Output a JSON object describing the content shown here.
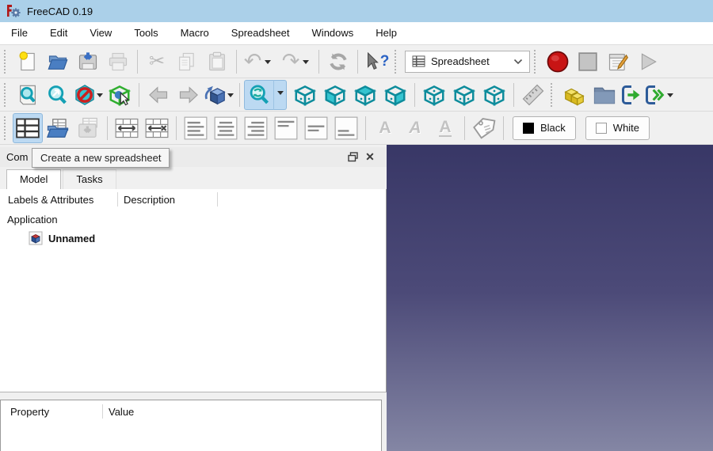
{
  "window": {
    "title": "FreeCAD 0.19"
  },
  "menu": {
    "items": [
      "File",
      "Edit",
      "View",
      "Tools",
      "Macro",
      "Spreadsheet",
      "Windows",
      "Help"
    ]
  },
  "workbench": {
    "selected": "Spreadsheet"
  },
  "color_buttons": {
    "black": "Black",
    "white": "White"
  },
  "tooltip": {
    "text": "Create a new spreadsheet"
  },
  "dock": {
    "title": "Com",
    "tabs": {
      "model": "Model",
      "tasks": "Tasks"
    },
    "tree": {
      "col1": "Labels & Attributes",
      "col2": "Description",
      "root": "Application",
      "document": "Unnamed"
    },
    "properties": {
      "col1": "Property",
      "col2": "Value"
    }
  },
  "glyphs": {
    "scissors": "✂",
    "undo": "↶",
    "redo": "↷",
    "close": "✕",
    "question": "?",
    "letter_a": "A"
  },
  "colors": {
    "titlebar": "#abd0e9",
    "highlight": "#bcd9f2",
    "record_red": "#c81414",
    "teal": "#2bbfca",
    "viewport_top": "#383766",
    "viewport_bottom": "#8486a4"
  }
}
